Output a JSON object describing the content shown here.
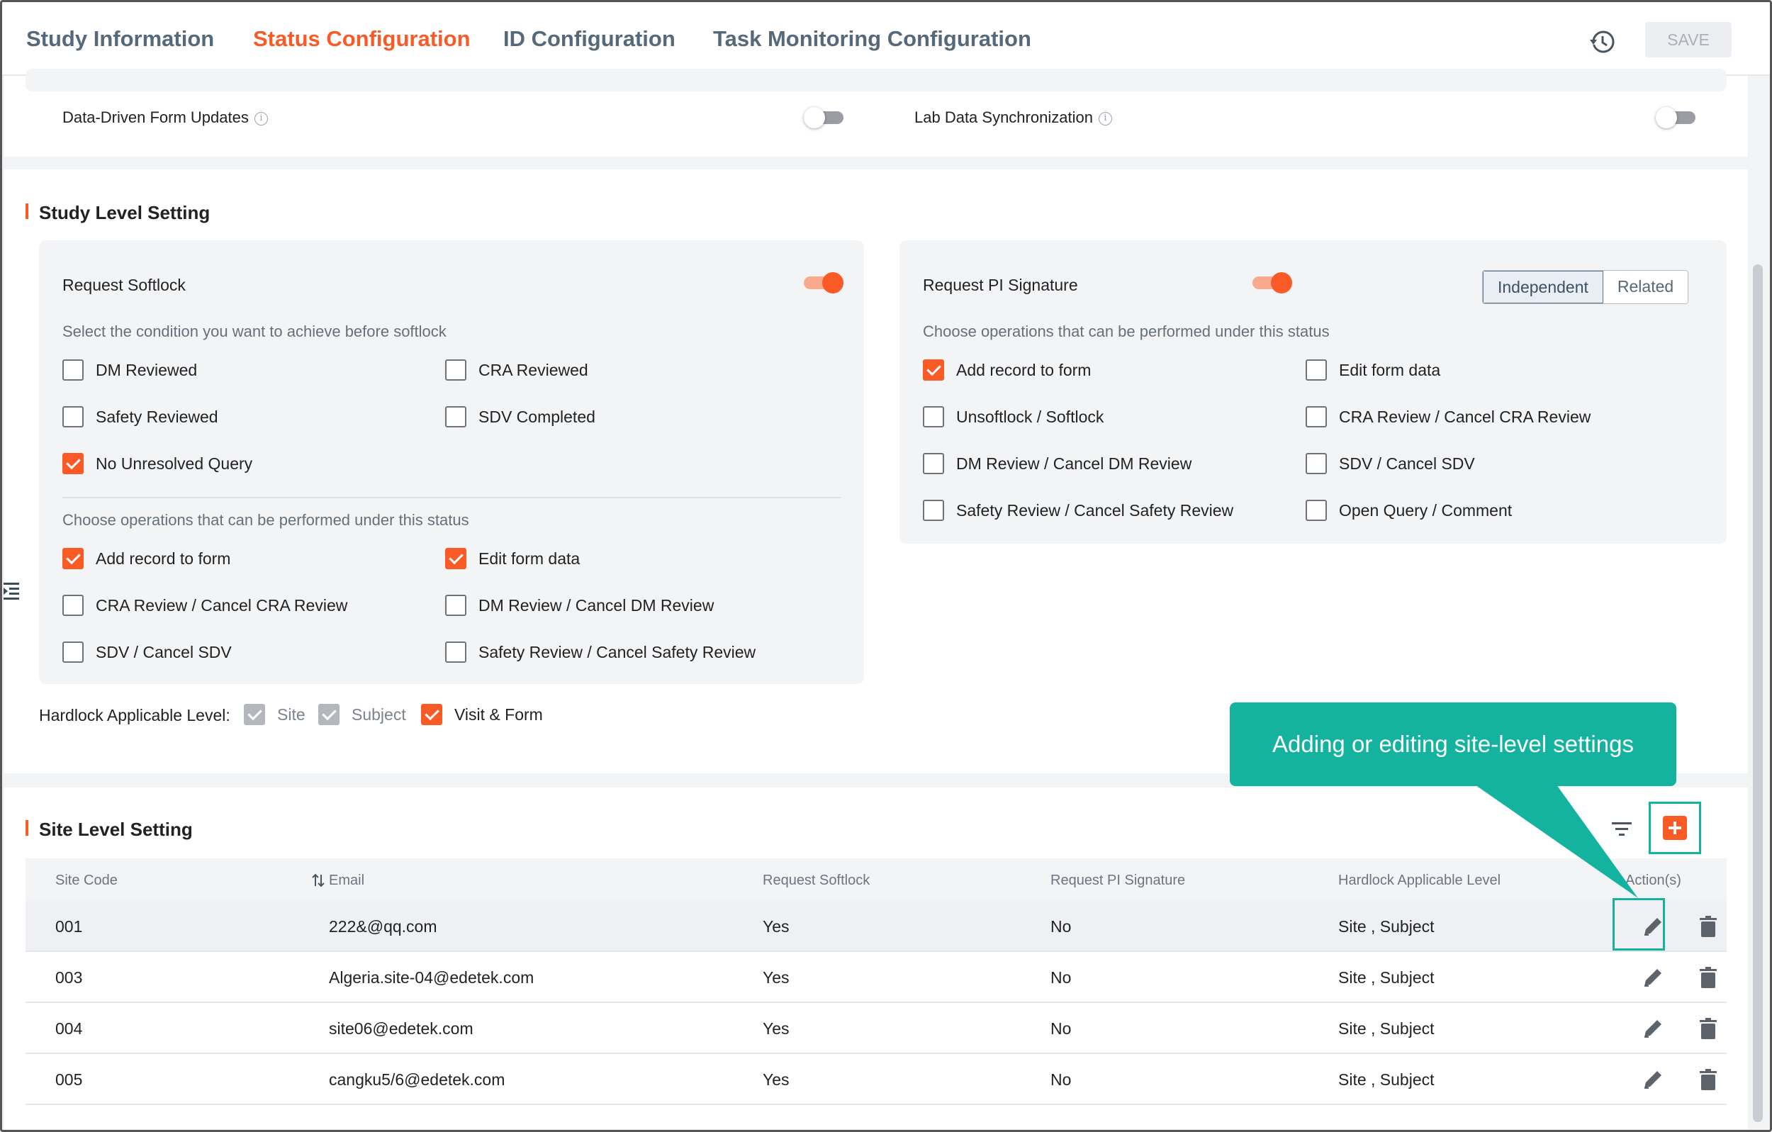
{
  "tabs": [
    {
      "label": "Study Information",
      "active": false
    },
    {
      "label": "Status Configuration",
      "active": true
    },
    {
      "label": "ID Configuration",
      "active": false
    },
    {
      "label": "Task Monitoring Configuration",
      "active": false
    }
  ],
  "header": {
    "save_label": "SAVE",
    "history_icon": "history-icon"
  },
  "sync": {
    "items": [
      {
        "label": "Data-Driven Form Updates",
        "enabled": false
      },
      {
        "label": "Lab Data Synchronization",
        "enabled": false
      }
    ]
  },
  "study_level": {
    "title": "Study Level Setting",
    "softlock": {
      "label": "Request Softlock",
      "enabled": true,
      "condition_hint": "Select the condition you want to achieve before softlock",
      "conditions": [
        {
          "label": "DM Reviewed",
          "checked": false
        },
        {
          "label": "CRA Reviewed",
          "checked": false
        },
        {
          "label": "Safety Reviewed",
          "checked": false
        },
        {
          "label": "SDV Completed",
          "checked": false
        },
        {
          "label": "No Unresolved Query",
          "checked": true
        }
      ],
      "operations_hint": "Choose operations that can be performed under this status",
      "operations": [
        {
          "label": "Add record to form",
          "checked": true
        },
        {
          "label": "Edit form data",
          "checked": true
        },
        {
          "label": "CRA Review / Cancel CRA Review",
          "checked": false
        },
        {
          "label": "DM Review / Cancel DM Review",
          "checked": false
        },
        {
          "label": "SDV / Cancel SDV",
          "checked": false
        },
        {
          "label": "Safety Review / Cancel Safety Review",
          "checked": false
        }
      ]
    },
    "pi_signature": {
      "label": "Request PI Signature",
      "enabled": true,
      "modes": [
        "Independent",
        "Related"
      ],
      "active_mode": "Independent",
      "operations_hint": "Choose operations that can be performed under this status",
      "operations": [
        {
          "label": "Add record to form",
          "checked": true
        },
        {
          "label": "Edit form data",
          "checked": false
        },
        {
          "label": "Unsoftlock / Softlock",
          "checked": false
        },
        {
          "label": "CRA Review / Cancel CRA Review",
          "checked": false
        },
        {
          "label": "DM Review / Cancel DM Review",
          "checked": false
        },
        {
          "label": "SDV / Cancel SDV",
          "checked": false
        },
        {
          "label": "Safety Review / Cancel Safety Review",
          "checked": false
        },
        {
          "label": "Open Query / Comment",
          "checked": false
        }
      ]
    },
    "hardlock": {
      "label": "Hardlock Applicable Level:",
      "levels": [
        {
          "label": "Site",
          "checked": true,
          "disabled": true
        },
        {
          "label": "Subject",
          "checked": true,
          "disabled": true
        },
        {
          "label": "Visit & Form",
          "checked": true,
          "disabled": false
        }
      ]
    }
  },
  "site_level": {
    "title": "Site Level Setting",
    "columns": [
      "Site Code",
      "Email",
      "Request Softlock",
      "Request PI Signature",
      "Hardlock Applicable Level",
      "Action(s)"
    ],
    "rows": [
      {
        "site_code": "001",
        "email": "222&@qq.com",
        "softlock": "Yes",
        "pi_signature": "No",
        "hardlock": "Site , Subject"
      },
      {
        "site_code": "003",
        "email": "Algeria.site-04@edetek.com",
        "softlock": "Yes",
        "pi_signature": "No",
        "hardlock": "Site , Subject"
      },
      {
        "site_code": "004",
        "email": "site06@edetek.com",
        "softlock": "Yes",
        "pi_signature": "No",
        "hardlock": "Site , Subject"
      },
      {
        "site_code": "005",
        "email": "cangku5/6@edetek.com",
        "softlock": "Yes",
        "pi_signature": "No",
        "hardlock": "Site , Subject"
      }
    ]
  },
  "callout": {
    "text": "Adding or editing site-level settings"
  },
  "colors": {
    "accent": "#fa5a26",
    "callout": "#14b3a0",
    "tab_inactive": "#55697a"
  }
}
